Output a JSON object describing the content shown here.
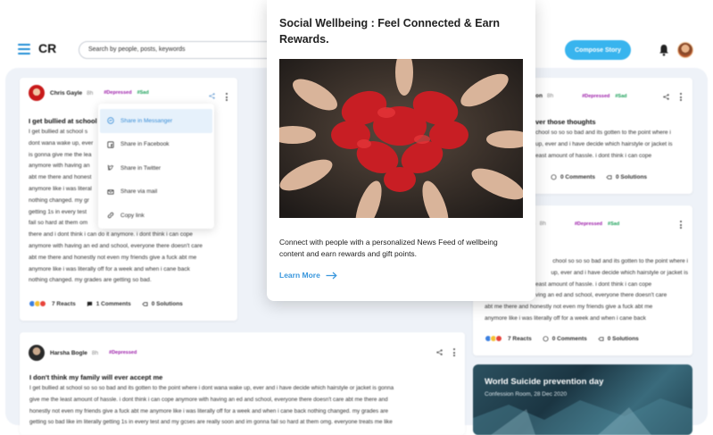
{
  "topbar": {
    "logo": "CR",
    "search_placeholder": "Search by people, posts, keywords",
    "compose_label": "Compose Story"
  },
  "posts": [
    {
      "author": "Chris Gayle",
      "time": "8h",
      "tags": [
        "#Depressed",
        "#Sad"
      ],
      "title": "I get bullied at school",
      "body_lines": [
        "I get bullied at school s",
        "dont wana wake up, ever",
        "is gonna give me the lea",
        "anymore with having an",
        "abt me there and honest",
        "anymore like i was literal",
        "nothing changed. my gr",
        "getting 1s in every test",
        "fail so hard at them om",
        "there and i dont think i can do it anymore. i dont think i can cope",
        "anymore with having an ed and school, everyone there doesn't care",
        "abt me there and honestly not even my friends give a fuck abt me",
        "anymore like i was literally off for a week and when i cane back",
        "nothing changed. my grades are getting so bad."
      ],
      "reacts": "7 Reacts",
      "comments": "1 Comments",
      "solutions": "0 Solutions"
    },
    {
      "author": "Harsha Bogle",
      "time": "8h",
      "tags": [
        "#Depressed"
      ],
      "title": "I don't think my family will ever accept me",
      "body_lines": [
        "I get bullied at school so so so bad and its gotten to the point where i dont wana wake up, ever and i have decide which hairstyle or jacket is gonna",
        "give me the least amount of hassle. i dont think i can cope anymore with having an ed and school, everyone there doesn't care abt me there and",
        "honestly not even my friends give a fuck abt me anymore like i was literally off for a week and when i cane back nothing changed. my grades are",
        "getting so bad like im literally getting 1s in every test and my gcses are really soon and im gonna fail so hard at them omg. everyone treats me like"
      ]
    },
    {
      "author_partial": "on",
      "time": "8h",
      "tags": [
        "#Depressed",
        "#Sad"
      ],
      "title_partial": "ver those thoughts",
      "body_lines": [
        "chool so so so bad and its gotten to the point where i",
        "up, ever and i have decide which hairstyle or jacket is",
        "east amount of hassle. i dont think i can cope"
      ],
      "comments": "0 Comments",
      "solutions": "0 Solutions"
    },
    {
      "author_partial": "s",
      "time": "8h",
      "tags": [
        "#Depressed",
        "#Sad"
      ],
      "body_lines": [
        "chool so so so bad and its gotten to the point where i",
        "up, ever and i have decide which hairstyle or jacket is",
        "east amount of hassle. i dont think i can cope",
        "ving an ed and school, everyone there doesn't care",
        "abt me there and honestly not even my friends give a fuck abt me",
        "anymore like i was literally off for a week and when i cane back"
      ],
      "reacts": "7 Reacts",
      "comments": "0 Comments",
      "solutions": "0 Solutions"
    }
  ],
  "share_menu": {
    "items": [
      "Share in Messanger",
      "Share in Facebook",
      "Share in Twitter",
      "Share via mail",
      "Copy link"
    ]
  },
  "event": {
    "title": "World Suicide prevention day",
    "subtitle": "Confession Room, 28 Dec 2020"
  },
  "modal": {
    "title": "Social Wellbeing : Feel Connected & Earn Rewards.",
    "description": "Connect with people with a personalized News Feed of wellbeing content and earn rewards and gift points.",
    "link_label": "Learn More"
  },
  "colors": {
    "accent": "#38b4ee",
    "link": "#3a97dd",
    "tag_purple": "#9b1aa8",
    "tag_green": "#1aa058",
    "feed_bg": "#eef2f8"
  },
  "icons": [
    "menu-icon",
    "search-field",
    "bell-icon",
    "share-icon",
    "more-vertical-icon",
    "comment-icon",
    "solution-icon",
    "messenger-icon",
    "facebook-icon",
    "twitter-icon",
    "mail-icon",
    "link-icon",
    "arrow-right-icon"
  ]
}
